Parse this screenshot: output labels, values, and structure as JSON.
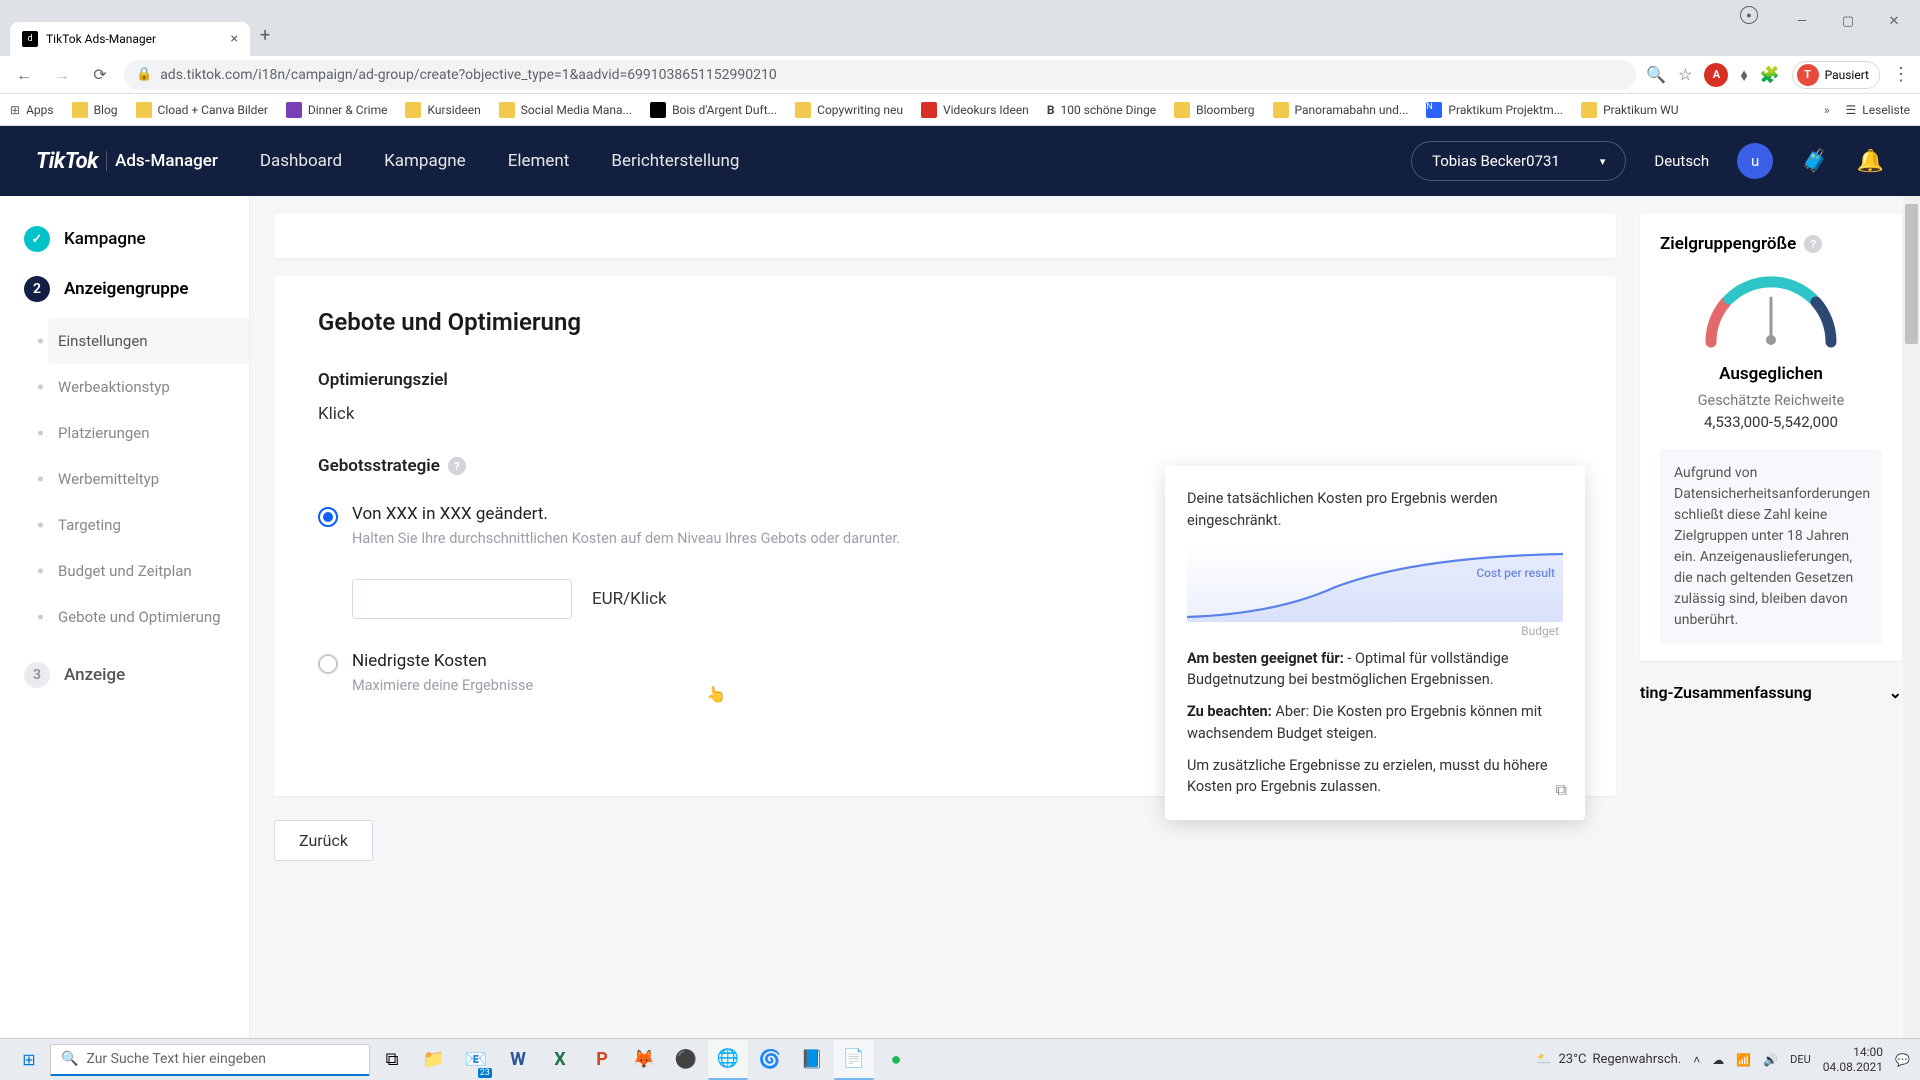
{
  "browser": {
    "tab_title": "TikTok Ads-Manager",
    "url": "ads.tiktok.com/i18n/campaign/ad-group/create?objective_type=1&aadvid=6991038651152990210",
    "profile_label": "Pausiert",
    "bookmarks": [
      "Apps",
      "Blog",
      "Cload + Canva Bilder",
      "Dinner & Crime",
      "Kursideen",
      "Social Media Mana...",
      "Bois d'Argent Duft...",
      "Copywriting neu",
      "Videokurs Ideen",
      "100 schöne Dinge",
      "Bloomberg",
      "Panoramabahn und...",
      "Praktikum Projektm...",
      "Praktikum WU"
    ],
    "reading_list": "Leseliste"
  },
  "header": {
    "logo": "TikTok",
    "logo_sub": "Ads-Manager",
    "nav": [
      "Dashboard",
      "Kampagne",
      "Element",
      "Berichterstellung"
    ],
    "user": "Tobias Becker0731",
    "lang": "Deutsch",
    "avatar_letter": "u"
  },
  "steps": {
    "s1": "Kampagne",
    "s2": "Anzeigengruppe",
    "s3": "Anzeige",
    "sub": [
      "Einstellungen",
      "Werbeaktionstyp",
      "Platzierungen",
      "Werbemitteltyp",
      "Targeting",
      "Budget und Zeitplan",
      "Gebote und Optimierung"
    ]
  },
  "main": {
    "section_title": "Gebote und Optimierung",
    "opt_label": "Optimierungsziel",
    "opt_value": "Klick",
    "strat_label": "Gebotsstrategie",
    "opt1_title": "Von XXX in XXX geändert.",
    "opt1_desc": "Halten Sie Ihre durchschnittlichen Kosten auf dem Niveau Ihres Gebots oder darunter.",
    "bid_unit": "EUR/Klick",
    "opt2_title": "Niedrigste Kosten",
    "opt2_desc": "Maximiere deine Ergebnisse",
    "back_btn": "Zurück"
  },
  "tooltip": {
    "head": "Deine tatsächlichen Kosten pro Ergebnis werden eingeschränkt.",
    "chart_cpr": "Cost per result",
    "chart_x": "Budget",
    "best_label": "Am besten geeignet für:",
    "best_text": " - Optimal für vollständige Budgetnutzung bei bestmöglichen Ergebnissen.",
    "note_label": "Zu beachten:",
    "note_text": " Aber: Die Kosten pro Ergebnis können mit wachsendem Budget steigen.",
    "extra": "Um zusätzliche Ergebnisse zu erzielen, musst du höhere Kosten pro Ergebnis zulassen."
  },
  "right": {
    "title": "Zielgruppengröße",
    "gauge_label": "Ausgeglichen",
    "reach_label": "Geschätzte Reichweite",
    "reach_value": "4,533,000-5,542,000",
    "info_text": "Aufgrund von Datensicherheitsanforderungen schließt diese Zahl keine Zielgruppen unter 18 Jahren ein. Anzeigenauslieferungen, die nach geltenden Gesetzen zulässig sind, bleiben davon unberührt.",
    "accordion": "ting-Zusammenfassung"
  },
  "taskbar": {
    "search_placeholder": "Zur Suche Text hier eingeben",
    "weather_temp": "23°C",
    "weather_text": "Regenwahrsch.",
    "time": "14:00",
    "date": "04.08.2021"
  },
  "colors": {
    "header": "#121f3e",
    "accent": "#0d5efa",
    "teal": "#2dc5c8"
  }
}
